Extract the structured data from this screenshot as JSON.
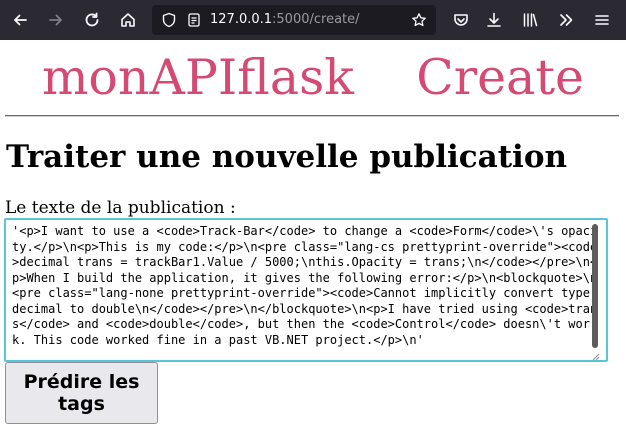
{
  "browser": {
    "url_host": "127.0.0.1",
    "url_path": ":5000/create/"
  },
  "page": {
    "site_name": "monAPIflask",
    "page_name": "Create",
    "heading": "Traiter une nouvelle publication",
    "field_label": "Le texte de la publication :",
    "textarea_value": "'<p>I want to use a <code>Track-Bar</code> to change a <code>Form</code>\\'s opacity.</p>\\n<p>This is my code:</p>\\n<pre class=\"lang-cs prettyprint-override\"><code>decimal trans = trackBar1.Value / 5000;\\nthis.Opacity = trans;\\n</code></pre>\\n<p>When I build the application, it gives the following error:</p>\\n<blockquote>\\n<pre class=\"lang-none prettyprint-override\"><code>Cannot implicitly convert type decimal to double\\n</code></pre>\\n</blockquote>\\n<p>I have tried using <code>trans</code> and <code>double</code>, but then the <code>Control</code> doesn\\'t work. This code worked fine in a past VB.NET project.</p>\\n'",
    "submit_label": "Prédire les tags"
  },
  "colors": {
    "title": "#d44a73",
    "toolbar_bg": "#2b2a33",
    "focus_border": "#58c7d3"
  }
}
